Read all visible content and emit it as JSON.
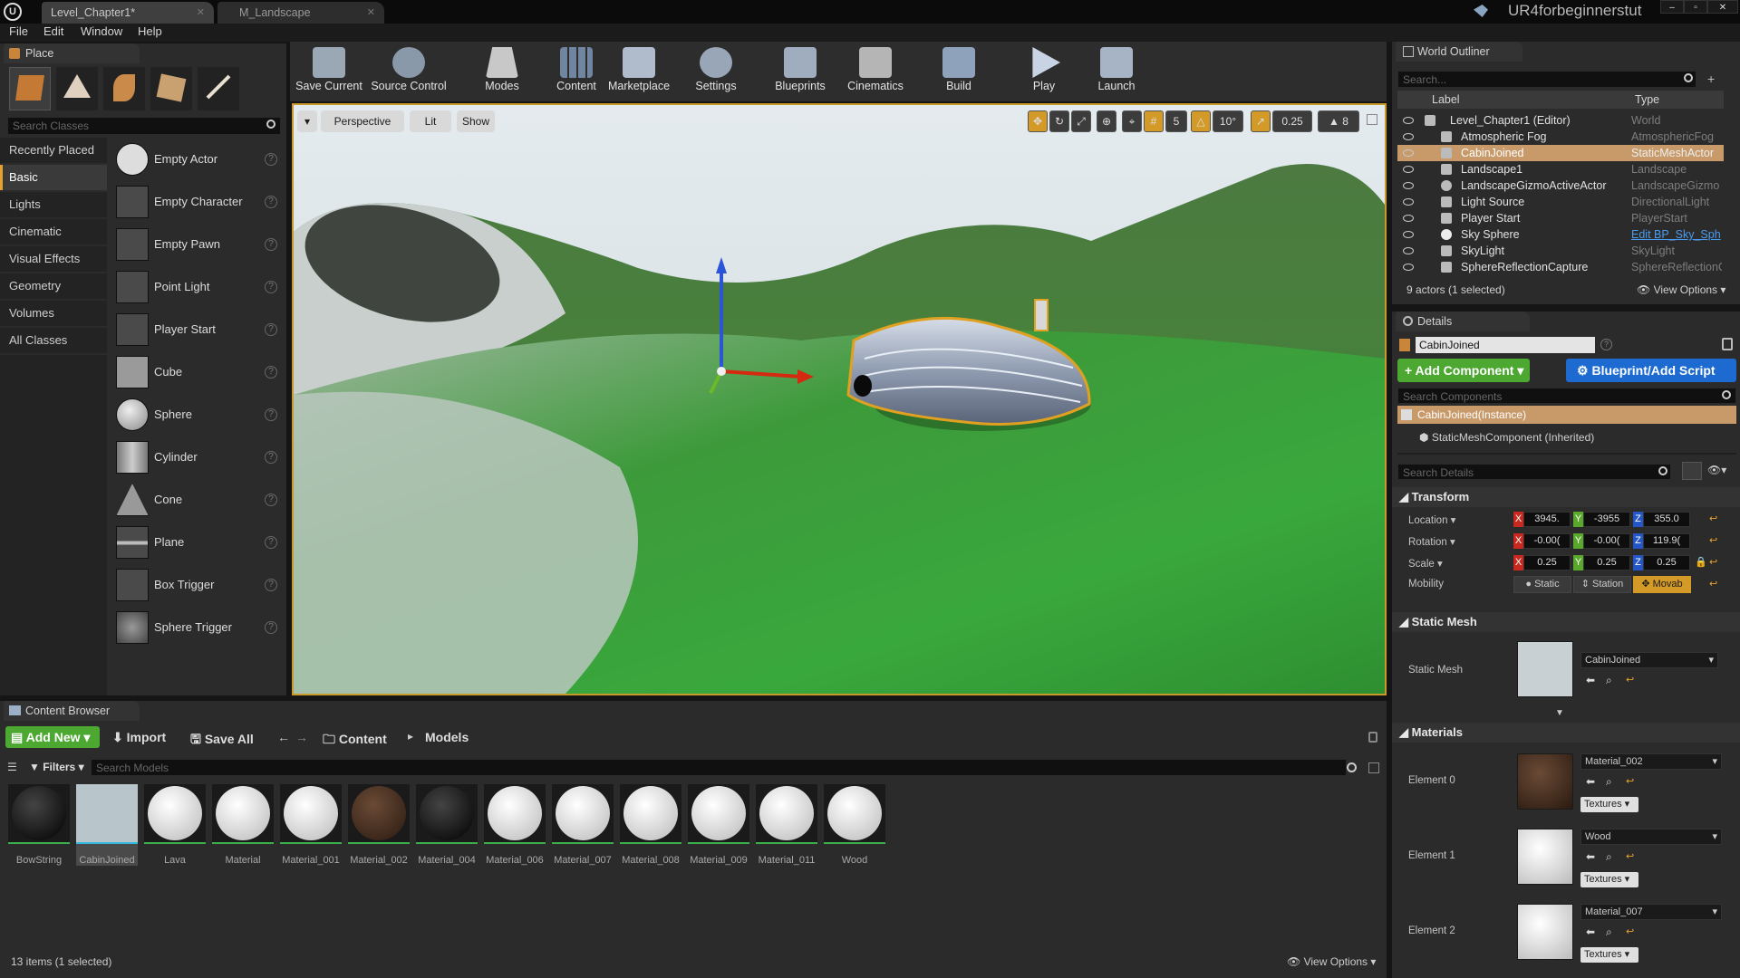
{
  "app": {
    "doc_tabs": [
      "Level_Chapter1*",
      "M_Landscape"
    ],
    "project_name": "UR4forbeginnerstut",
    "menu": [
      "File",
      "Edit",
      "Window",
      "Help"
    ]
  },
  "place_panel": {
    "tab": "Place",
    "search_placeholder": "Search Classes",
    "categories": [
      "Recently Placed",
      "Basic",
      "Lights",
      "Cinematic",
      "Visual Effects",
      "Geometry",
      "Volumes",
      "All Classes"
    ],
    "selected_category": "Basic",
    "items": [
      "Empty Actor",
      "Empty Character",
      "Empty Pawn",
      "Point Light",
      "Player Start",
      "Cube",
      "Sphere",
      "Cylinder",
      "Cone",
      "Plane",
      "Box Trigger",
      "Sphere Trigger"
    ]
  },
  "toolbar": {
    "buttons": [
      "Save Current",
      "Source Control",
      "Modes",
      "Content",
      "Marketplace",
      "Settings",
      "Blueprints",
      "Cinematics",
      "Build",
      "Play",
      "Launch"
    ]
  },
  "viewport": {
    "perspective": "Perspective",
    "lit": "Lit",
    "show": "Show",
    "grid_snap": "5",
    "rot_snap": "10°",
    "scale_snap": "0.25",
    "camera_speed": "8"
  },
  "outliner": {
    "tab": "World Outliner",
    "search_placeholder": "Search...",
    "col_label": "Label",
    "col_type": "Type",
    "rows": [
      {
        "label": "Level_Chapter1 (Editor)",
        "type": "World"
      },
      {
        "label": "Atmospheric Fog",
        "type": "AtmosphericFog"
      },
      {
        "label": "CabinJoined",
        "type": "StaticMeshActor"
      },
      {
        "label": "Landscape1",
        "type": "Landscape"
      },
      {
        "label": "LandscapeGizmoActiveActor",
        "type": "LandscapeGizmo"
      },
      {
        "label": "Light Source",
        "type": "DirectionalLight"
      },
      {
        "label": "Player Start",
        "type": "PlayerStart"
      },
      {
        "label": "Sky Sphere",
        "type": "Edit BP_Sky_Sph"
      },
      {
        "label": "SkyLight",
        "type": "SkyLight"
      },
      {
        "label": "SphereReflectionCapture",
        "type": "SphereReflectionC"
      }
    ],
    "summary": "9 actors (1 selected)",
    "view_options": "View Options"
  },
  "details": {
    "tab": "Details",
    "name": "CabinJoined",
    "add_component": "Add Component",
    "blueprint": "Blueprint/Add Script",
    "search_components_placeholder": "Search Components",
    "instance": "CabinJoined(Instance)",
    "component": "StaticMeshComponent (Inherited)",
    "search_details_placeholder": "Search Details",
    "transform_header": "Transform",
    "location_label": "Location",
    "rotation_label": "Rotation",
    "scale_label": "Scale",
    "mobility_label": "Mobility",
    "location": [
      "3945.",
      "-3955",
      "355.0"
    ],
    "rotation": [
      "-0.00(",
      "-0.00(",
      "119.9("
    ],
    "scale": [
      "0.25",
      "0.25",
      "0.25"
    ],
    "axes": [
      "X",
      "Y",
      "Z"
    ],
    "mobility": [
      "Static",
      "Station",
      "Movab"
    ],
    "static_mesh_header": "Static Mesh",
    "static_mesh_label": "Static Mesh",
    "static_mesh_value": "CabinJoined",
    "materials_header": "Materials",
    "elements": [
      {
        "label": "Element 0",
        "material": "Material_002"
      },
      {
        "label": "Element 1",
        "material": "Wood"
      },
      {
        "label": "Element 2",
        "material": "Material_007"
      }
    ],
    "textures_btn": "Textures"
  },
  "content_browser": {
    "tab": "Content Browser",
    "add_new": "Add New",
    "import": "Import",
    "save_all": "Save All",
    "path": [
      "Content",
      "Models"
    ],
    "filters": "Filters",
    "search_placeholder": "Search Models",
    "assets": [
      "BowString",
      "CabinJoined",
      "Lava",
      "Material",
      "Material_001",
      "Material_002",
      "Material_004",
      "Material_006",
      "Material_007",
      "Material_008",
      "Material_009",
      "Material_011",
      "Wood"
    ],
    "summary": "13 items (1 selected)",
    "view_options": "View Options"
  }
}
